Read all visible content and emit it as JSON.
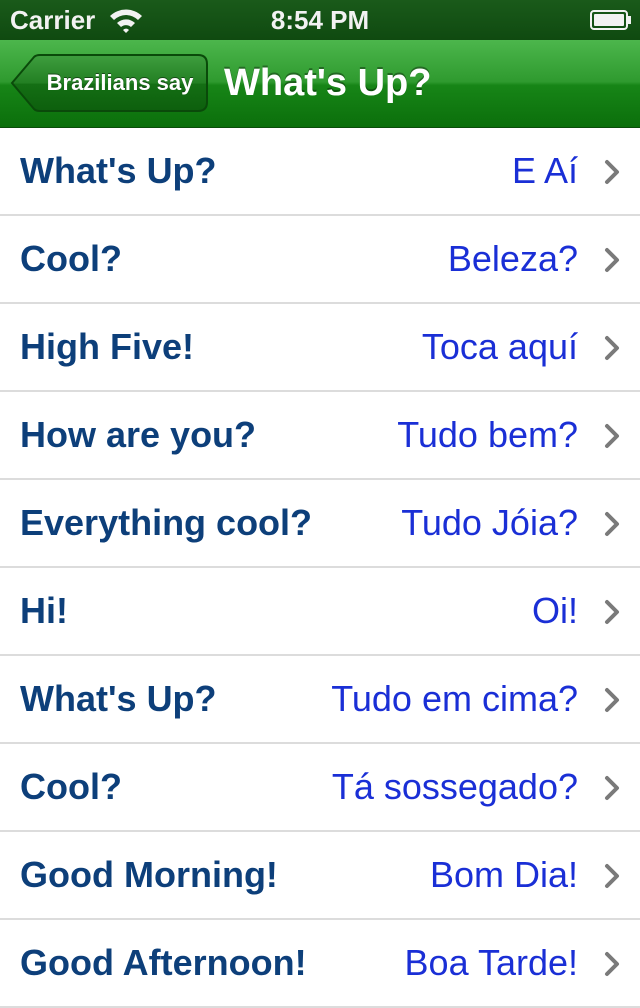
{
  "status_bar": {
    "carrier": "Carrier",
    "time": "8:54 PM",
    "wifi_icon": "wifi-icon",
    "battery_icon": "battery-icon"
  },
  "nav": {
    "back_label": "Brazilians say",
    "title": "What's Up?",
    "color": "#1f8f1f"
  },
  "colors": {
    "english_text": "#0d3f7a",
    "portuguese_text": "#1a2fd6",
    "separator": "#dcdcdc"
  },
  "phrases": [
    {
      "english": "What's Up?",
      "portuguese": "E Aí"
    },
    {
      "english": "Cool?",
      "portuguese": "Beleza?"
    },
    {
      "english": "High Five!",
      "portuguese": "Toca aquí"
    },
    {
      "english": "How are you?",
      "portuguese": "Tudo bem?"
    },
    {
      "english": "Everything cool?",
      "portuguese": "Tudo Jóia?"
    },
    {
      "english": "Hi!",
      "portuguese": "Oi!"
    },
    {
      "english": "What's Up?",
      "portuguese": "Tudo em cima?"
    },
    {
      "english": "Cool?",
      "portuguese": "Tá sossegado?"
    },
    {
      "english": "Good Morning!",
      "portuguese": "Bom Dia!"
    },
    {
      "english": "Good Afternoon!",
      "portuguese": "Boa Tarde!"
    }
  ]
}
